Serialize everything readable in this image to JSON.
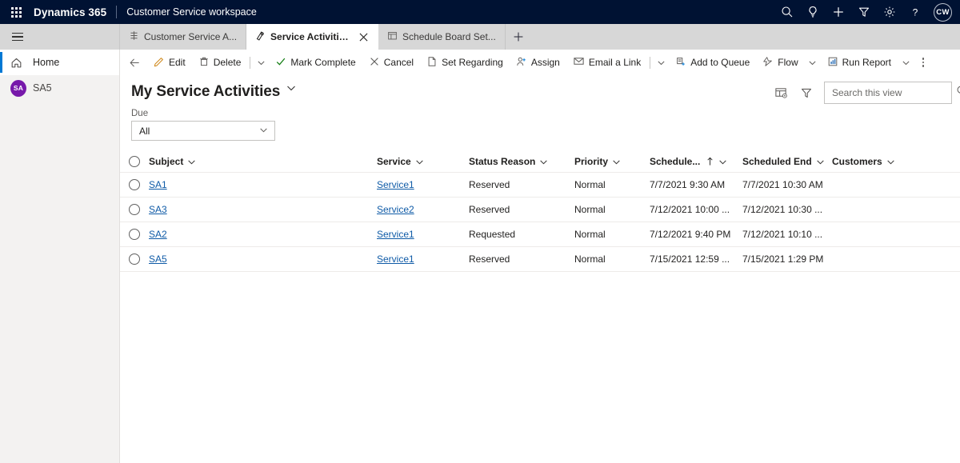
{
  "topbar": {
    "waffle_label": "app-launcher",
    "brand": "Dynamics 365",
    "app_name": "Customer Service workspace",
    "icons": [
      "search-icon",
      "insights-lightbulb-icon",
      "new-plus-icon",
      "filter-icon",
      "settings-gear-icon",
      "help-question-icon"
    ],
    "avatar_initials": "CW",
    "background_color": "#001233"
  },
  "tabs": {
    "items": [
      {
        "label": "Customer Service A...",
        "icon": "dashboard-icon",
        "active": false,
        "closable": false
      },
      {
        "label": "Service Activities My Ser...",
        "icon": "service-activity-icon",
        "active": true,
        "closable": true
      },
      {
        "label": "Schedule Board Set...",
        "icon": "schedule-board-icon",
        "active": false,
        "closable": false
      }
    ],
    "new_tab_label": "+"
  },
  "sidebar": {
    "items": [
      {
        "label": "Home",
        "icon": "home-icon",
        "active": true,
        "type": "nav"
      },
      {
        "label": "SA5",
        "icon": "avatar",
        "initials": "SA",
        "avatar_color": "#7719aa",
        "active": false,
        "type": "session"
      }
    ]
  },
  "commandbar": {
    "back_label": "Back",
    "items": [
      {
        "label": "Edit",
        "icon": "pencil-icon",
        "caret": false
      },
      {
        "label": "Delete",
        "icon": "trash-icon",
        "caret": false
      },
      {
        "label": "",
        "icon": "chevron-down-icon",
        "caret": true,
        "divider_before": true
      },
      {
        "label": "Mark Complete",
        "icon": "checkmark-icon",
        "caret": false
      },
      {
        "label": "Cancel",
        "icon": "cancel-x-icon",
        "caret": false
      },
      {
        "label": "Set Regarding",
        "icon": "set-regarding-icon",
        "caret": false
      },
      {
        "label": "Assign",
        "icon": "assign-person-icon",
        "caret": false
      },
      {
        "label": "Email a Link",
        "icon": "email-link-icon",
        "caret": false
      },
      {
        "label": "",
        "icon": "chevron-down-icon",
        "caret": true,
        "divider_before": true
      },
      {
        "label": "Add to Queue",
        "icon": "add-to-queue-icon",
        "caret": false
      },
      {
        "label": "Flow",
        "icon": "flow-icon",
        "caret": true
      },
      {
        "label": "Run Report",
        "icon": "run-report-icon",
        "caret": true
      }
    ],
    "overflow_label": "More commands"
  },
  "view": {
    "title": "My Service Activities",
    "title_caret": "chevron-down-icon",
    "edit_columns_icon": "edit-columns-icon",
    "edit_filters_icon": "filter-icon",
    "search": {
      "placeholder": "Search this view",
      "value": "",
      "icon": "search-icon"
    }
  },
  "filters": {
    "due": {
      "label": "Due",
      "value": "All",
      "caret": "chevron-down-icon"
    }
  },
  "grid": {
    "select_all_label": "select-all",
    "columns": [
      {
        "key": "subject",
        "label": "Subject",
        "sorted": false
      },
      {
        "key": "service",
        "label": "Service",
        "sorted": false
      },
      {
        "key": "status",
        "label": "Status Reason",
        "sorted": false
      },
      {
        "key": "priority",
        "label": "Priority",
        "sorted": false
      },
      {
        "key": "schst",
        "label": "Schedule...",
        "sorted": true,
        "sort_dir": "asc"
      },
      {
        "key": "schend",
        "label": "Scheduled End",
        "sorted": false
      },
      {
        "key": "cust",
        "label": "Customers",
        "sorted": false
      }
    ],
    "rows": [
      {
        "subject": "SA1",
        "service": "Service1",
        "status": "Reserved",
        "priority": "Normal",
        "schst": "7/7/2021 9:30 AM",
        "schend": "7/7/2021 10:30 AM",
        "cust": ""
      },
      {
        "subject": "SA3",
        "service": "Service2",
        "status": "Reserved",
        "priority": "Normal",
        "schst": "7/12/2021 10:00 ...",
        "schend": "7/12/2021 10:30 ...",
        "cust": ""
      },
      {
        "subject": "SA2",
        "service": "Service1",
        "status": "Requested",
        "priority": "Normal",
        "schst": "7/12/2021 9:40 PM",
        "schend": "7/12/2021 10:10 ...",
        "cust": ""
      },
      {
        "subject": "SA5",
        "service": "Service1",
        "status": "Reserved",
        "priority": "Normal",
        "schst": "7/15/2021 12:59 ...",
        "schend": "7/15/2021 1:29 PM",
        "cust": ""
      }
    ]
  },
  "colors": {
    "nav_bg": "#001233",
    "tabstrip_bg": "#d7d7d7",
    "link": "#0f5ba7",
    "accent": "#0078d4",
    "avatar_purple": "#7719aa"
  }
}
